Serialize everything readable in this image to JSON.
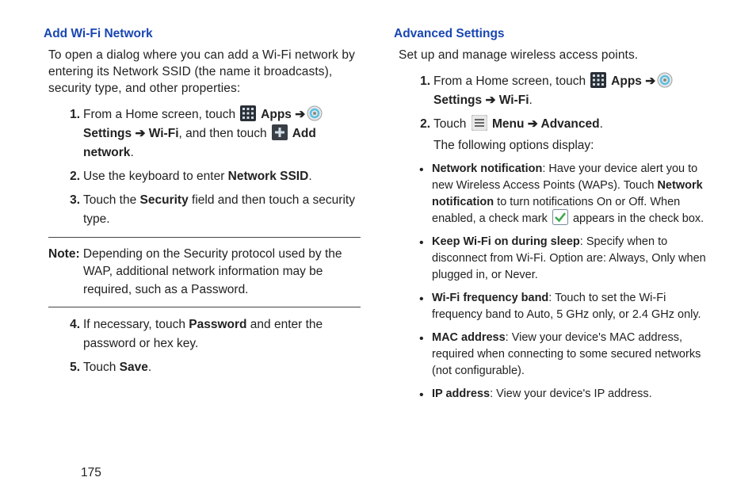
{
  "pageNumber": "175",
  "left": {
    "heading": "Add Wi-Fi Network",
    "intro": "To open a dialog where you can add a Wi-Fi network by entering its Network SSID (the name it broadcasts), security type, and other properties:",
    "step1_pre": "From a Home screen, touch ",
    "app_label": " Apps ",
    "arrow": "➔",
    "settings_label": " Settings ",
    "wifi_label": " Wi-Fi",
    "step1_mid": ", and then touch ",
    "addnet_label": " Add network",
    "step2_pre": "Use the keyboard to enter ",
    "step2_bold": "Network SSID",
    "step3_pre": "Touch the ",
    "step3_bold": "Security",
    "step3_post": " field and then touch a security type.",
    "note_label": "Note:",
    "note_body": " Depending on the Security protocol used by the WAP, additional network information may be required, such as a Password.",
    "step4_pre": "If necessary, touch ",
    "step4_bold": "Password",
    "step4_post": " and enter the password or hex key.",
    "step5_pre": "Touch ",
    "step5_bold": "Save"
  },
  "right": {
    "heading": "Advanced Settings",
    "intro": "Set up and manage wireless access points.",
    "step1_pre": "From a Home screen, touch ",
    "app_label": " Apps ",
    "arrow": "➔",
    "settings_label": " Settings ",
    "wifi_label": " Wi-Fi",
    "step2_pre": "Touch ",
    "menu_label": " Menu ",
    "advanced_label": " Advanced",
    "follow": "The following options display:",
    "b1_bold": "Network notification",
    "b1_a": ": Have your device alert you to new Wireless Access Points (WAPs). Touch ",
    "b1_bold2": "Network notification",
    "b1_b": " to turn notifications On or Off. When enabled, a check mark ",
    "b1_c": " appears in the check box.",
    "b2_bold": "Keep Wi-Fi on during sleep",
    "b2_body": ": Specify when to disconnect from Wi-Fi. Option are: Always, Only when plugged in, or Never.",
    "b3_bold": "Wi-Fi frequency band",
    "b3_body": ": Touch to set the Wi-Fi frequency band to Auto, 5 GHz only, or 2.4 GHz only.",
    "b4_bold": "MAC address",
    "b4_body": ": View your device's MAC address, required when connecting to some secured networks (not configurable).",
    "b5_bold": "IP address",
    "b5_body": ": View your device's IP address."
  }
}
